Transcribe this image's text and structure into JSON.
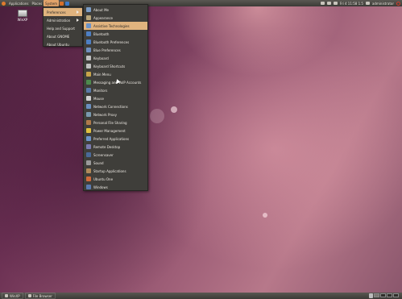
{
  "top_panel": {
    "menus": [
      "Applications",
      "Places",
      "System"
    ],
    "clock": "Fri 4 11:58 1.5",
    "user": "administrator"
  },
  "desktop": {
    "icon_label": "WinXP"
  },
  "system_menu": {
    "items": [
      "Preferences",
      "Administration",
      "Help and Support",
      "About GNOME",
      "About Ubuntu"
    ]
  },
  "preferences_menu": {
    "items": [
      "About Me",
      "Appearance",
      "Assistive Technologies",
      "Bluetooth",
      "Bluetooth Preferences",
      "Blue Preferences",
      "Keyboard",
      "Keyboard Shortcuts",
      "Main Menu",
      "Messaging and VoIP Accounts",
      "Monitors",
      "Mouse",
      "Network Connections",
      "Network Proxy",
      "Personal File Sharing",
      "Power Management",
      "Preferred Applications",
      "Remote Desktop",
      "Screensaver",
      "Sound",
      "Startup Applications",
      "Ubuntu One",
      "Windows"
    ],
    "icon_colors": [
      "#7a9cc6",
      "#b9a57a",
      "#6a93c9",
      "#4d7fc4",
      "#4d7fc4",
      "#6f8fbf",
      "#c0c0c0",
      "#c0c0c0",
      "#c9a44a",
      "#4d8a4d",
      "#5a7aa8",
      "#d0d0d0",
      "#6a8fc0",
      "#7a9ab0",
      "#b07a4a",
      "#e0c040",
      "#6a93c9",
      "#7a7ab0",
      "#4a6a9a",
      "#9a9a9a",
      "#b08a5a",
      "#d06a3a",
      "#5a7ab0"
    ]
  },
  "bottom_panel": {
    "task1": "WinXP",
    "task2": "File Browser"
  }
}
